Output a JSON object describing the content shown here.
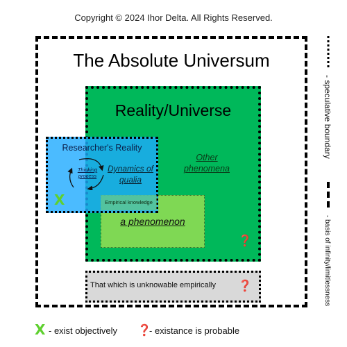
{
  "copyright": "Copyright © 2024 Ihor Delta. All Rights Reserved.",
  "absolute": {
    "title": "The Absolute Universum"
  },
  "reality": {
    "title": "Reality/Universe",
    "other_phenomena": "Other phenomena"
  },
  "a_phenomenon": {
    "label": "a phenomenon"
  },
  "researcher": {
    "title": "Researcher's Reality",
    "thinking": "Thinking process",
    "dynamics": "Dynamics of qualia",
    "empirical": "Empirical knowledge"
  },
  "unknowable": {
    "label": "That which is unknowable empirically"
  },
  "side_legend": {
    "speculative": "- speculative boundary",
    "infinity": "- basis of infinity/limitlessness"
  },
  "legend": {
    "exist_label": "- exist objectively",
    "probable_label": "- existance is probable"
  },
  "symbols": {
    "x_mark": "X",
    "question_mark": "❓"
  },
  "colors": {
    "reality_green": "#00b85a",
    "phenomenon_green": "#7fd854",
    "researcher_blue": "#1eaaff",
    "unknowable_gray": "#d9d9d9",
    "x_green": "#5fd02f",
    "question_red": "#d42a2a"
  }
}
